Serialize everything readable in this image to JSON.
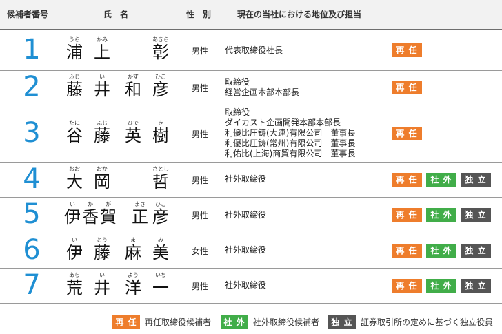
{
  "header": {
    "col_number": "候補者番号",
    "col_name": "氏　名",
    "col_gender": "性　別",
    "col_position": "現在の当社における地位及び担当"
  },
  "candidates": [
    {
      "number": "1",
      "gender": "男性",
      "name": [
        {
          "k": "浦",
          "r": "うら"
        },
        {
          "k": "上",
          "r": "かみ"
        },
        {
          "k": "彰",
          "r": "あきら"
        }
      ],
      "position": [
        "代表取締役社長"
      ],
      "badges": [
        "再 任"
      ]
    },
    {
      "number": "2",
      "gender": "男性",
      "name": [
        {
          "k": "藤",
          "r": "ふじ"
        },
        {
          "k": "井",
          "r": "い"
        },
        {
          "k": "和",
          "r": "かず"
        },
        {
          "k": "彦",
          "r": "ひこ"
        }
      ],
      "position": [
        "取締役",
        "経営企画本部本部長"
      ],
      "badges": [
        "再 任"
      ]
    },
    {
      "number": "3",
      "gender": "男性",
      "name": [
        {
          "k": "谷",
          "r": "たに"
        },
        {
          "k": "藤",
          "r": "ふじ"
        },
        {
          "k": "英",
          "r": "ひで"
        },
        {
          "k": "樹",
          "r": "き"
        }
      ],
      "position": [
        "取締役",
        "ダイカスト企画開発本部本部長",
        "利優比圧鋳(大連)有限公司　董事長",
        "利優比圧鋳(常州)有限公司　董事長",
        "利佑比(上海)商貿有限公司　董事長"
      ],
      "badges": [
        "再 任"
      ]
    },
    {
      "number": "4",
      "gender": "男性",
      "name": [
        {
          "k": "大",
          "r": "おお"
        },
        {
          "k": "岡",
          "r": "おか"
        },
        {
          "k": "哲",
          "r": "さとし"
        }
      ],
      "position": [
        "社外取締役"
      ],
      "badges": [
        "再 任",
        "社 外",
        "独 立"
      ]
    },
    {
      "number": "5",
      "gender": "男性",
      "name": [
        {
          "k": "伊",
          "r": "い"
        },
        {
          "k": "香",
          "r": "か"
        },
        {
          "k": "賀",
          "r": "が"
        },
        {
          "k": "正",
          "r": "まさ"
        },
        {
          "k": "彦",
          "r": "ひこ"
        }
      ],
      "position": [
        "社外取締役"
      ],
      "badges": [
        "再 任",
        "社 外",
        "独 立"
      ]
    },
    {
      "number": "6",
      "gender": "女性",
      "name": [
        {
          "k": "伊",
          "r": "い"
        },
        {
          "k": "藤",
          "r": "とう"
        },
        {
          "k": "麻",
          "r": "ま"
        },
        {
          "k": "美",
          "r": "み"
        }
      ],
      "position": [
        "社外取締役"
      ],
      "badges": [
        "再 任",
        "社 外",
        "独 立"
      ]
    },
    {
      "number": "7",
      "gender": "男性",
      "name": [
        {
          "k": "荒",
          "r": "あら"
        },
        {
          "k": "井",
          "r": "い"
        },
        {
          "k": "洋",
          "r": "よう"
        },
        {
          "k": "一",
          "r": "いち"
        }
      ],
      "position": [
        "社外取締役"
      ],
      "badges": [
        "再 任",
        "社 外",
        "独 立"
      ]
    }
  ],
  "legend": [
    {
      "badge": "再 任",
      "text": "再任取締役候補者"
    },
    {
      "badge": "社 外",
      "text": "社外取締役候補者"
    },
    {
      "badge": "独 立",
      "text": "証券取引所の定めに基づく独立役員"
    }
  ],
  "colors": {
    "reappointment": "#ee7d2c",
    "outside": "#41ad49",
    "independent": "#555555",
    "number": "#1f8fd3"
  }
}
